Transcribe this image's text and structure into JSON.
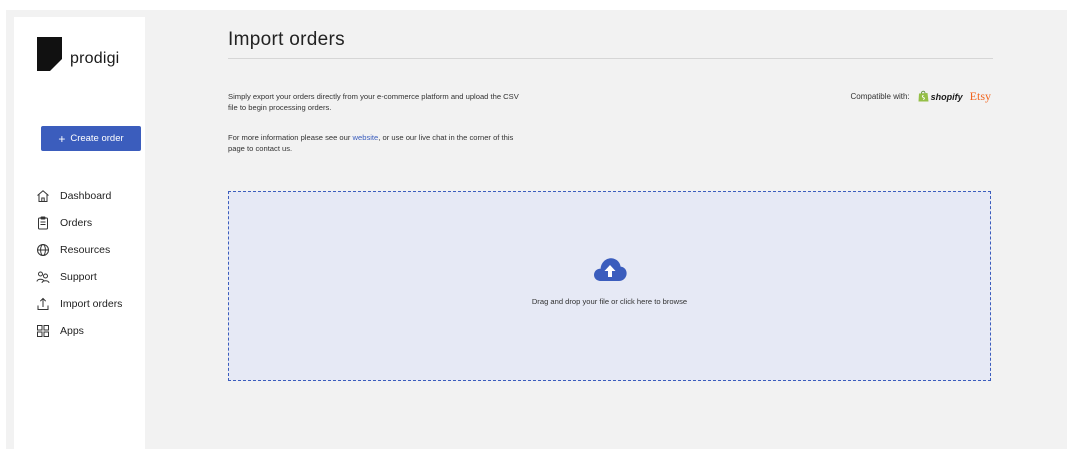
{
  "brand": {
    "name": "prodigi"
  },
  "sidebar": {
    "create_button": {
      "icon": "plus-icon",
      "label": "Create order"
    },
    "items": [
      {
        "icon": "home-icon",
        "label": "Dashboard"
      },
      {
        "icon": "clipboard-icon",
        "label": "Orders"
      },
      {
        "icon": "globe-icon",
        "label": "Resources"
      },
      {
        "icon": "users-icon",
        "label": "Support"
      },
      {
        "icon": "upload-icon",
        "label": "Import orders"
      },
      {
        "icon": "grid-icon",
        "label": "Apps"
      }
    ]
  },
  "main": {
    "title": "Import orders",
    "description": "Simply export your orders directly from your e-commerce platform and upload the CSV file to begin processing orders.",
    "info_prefix": "For more information please see our ",
    "info_link": "website",
    "info_suffix": ", or use our live chat in the corner of this page to contact us.",
    "compatible_label": "Compatible with:",
    "platforms": [
      "shopify",
      "Etsy"
    ],
    "dropzone_text": "Drag and drop your file or click here to browse"
  },
  "colors": {
    "accent": "#3b5dbd",
    "dropzone_bg": "#e6e9f5",
    "etsy": "#f1641e",
    "shopify": "#95bf47"
  }
}
